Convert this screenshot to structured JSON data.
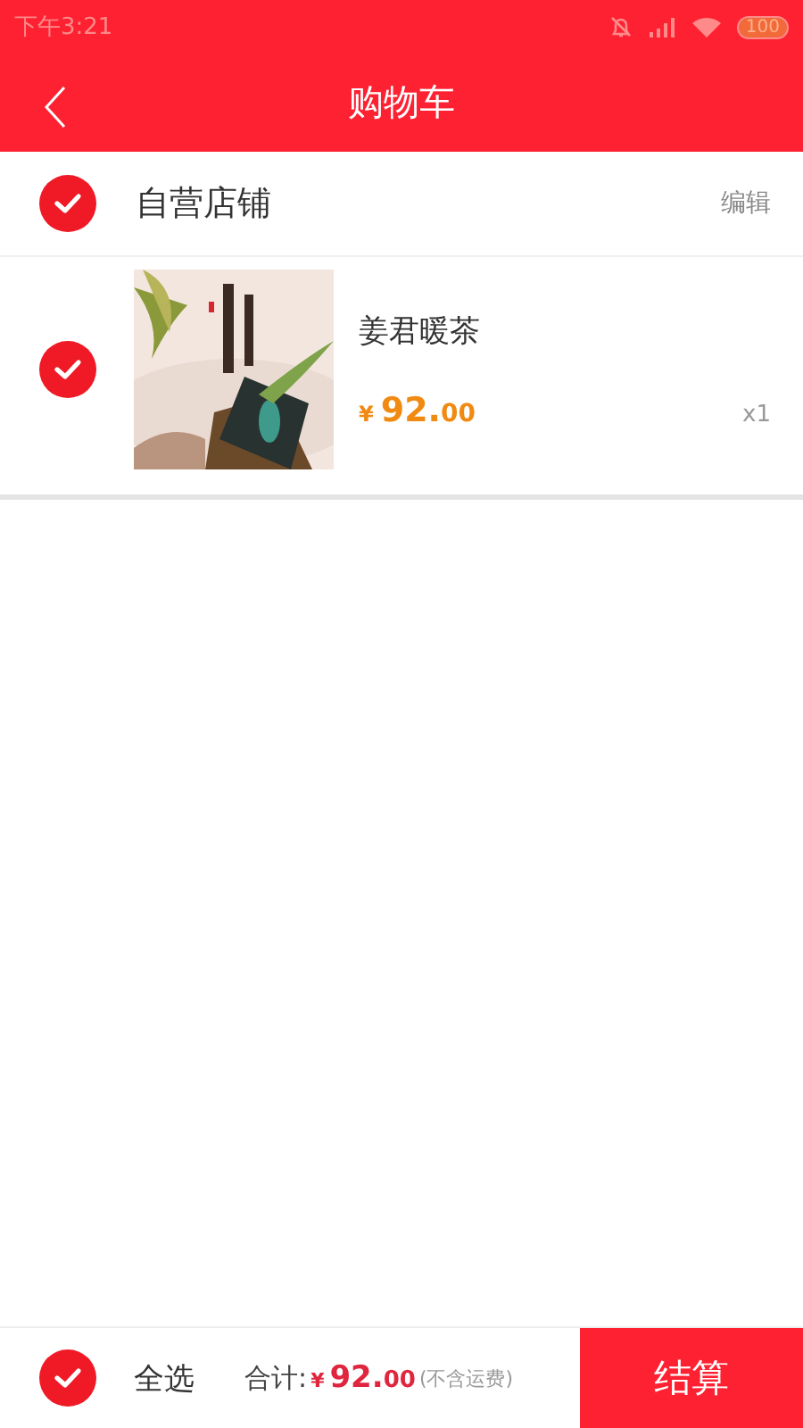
{
  "status_bar": {
    "time": "下午3:21",
    "battery": "100"
  },
  "header": {
    "title": "购物车"
  },
  "shops": [
    {
      "name": "自营店铺",
      "edit": "编辑",
      "checked": true,
      "items": [
        {
          "name": "姜君暖茶",
          "checked": true,
          "kind": "picture",
          "price": {
            "currency": "¥",
            "integer": "92.",
            "decimal": "00"
          },
          "quantity": "x1"
        }
      ]
    }
  ],
  "footer": {
    "select_all": {
      "label": "全选",
      "checked": true
    },
    "total_label": "合计:",
    "total": {
      "currency": "¥",
      "integer": "92.",
      "decimal": "00"
    },
    "note": "(不含运费)",
    "checkout": "结算"
  }
}
